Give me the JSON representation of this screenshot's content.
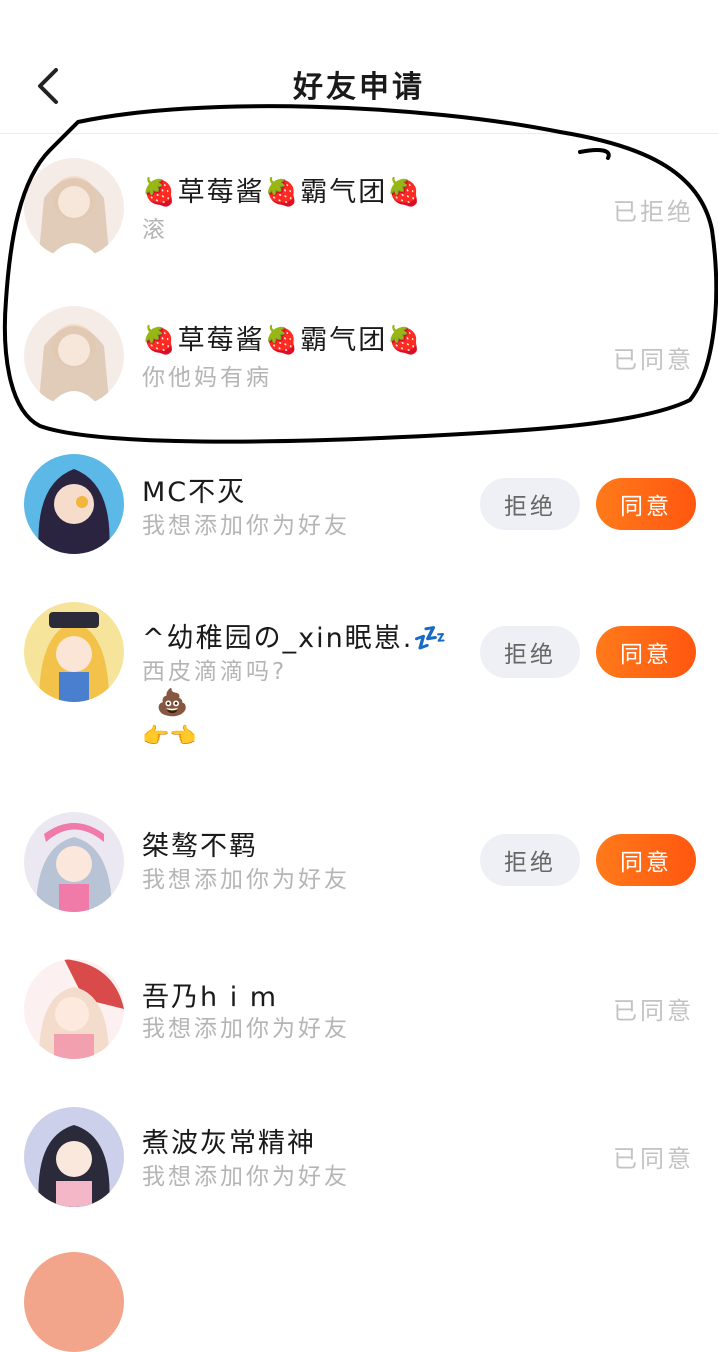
{
  "header": {
    "title": "好友申请",
    "back_icon": "chevron-left-icon"
  },
  "requests": [
    {
      "name": "🍓草莓酱🍓霸气团🍓",
      "message": "滚",
      "status": "已拒绝",
      "avatar_colors": [
        "#f3e6e0",
        "#d9c2b0"
      ]
    },
    {
      "name": "🍓草莓酱🍓霸气团🍓",
      "message": "你他妈有病",
      "status": "已同意",
      "avatar_colors": [
        "#f3e6e0",
        "#d9c2b0"
      ]
    },
    {
      "name": "MC不灭",
      "message": "我想添加你为好友",
      "reject_label": "拒绝",
      "accept_label": "同意",
      "avatar_colors": [
        "#4aa6d6",
        "#2b2440"
      ]
    },
    {
      "name": "^幼稚园の_xin眠崽.💤",
      "message": "西皮滴滴吗?",
      "extra_line1": "💩",
      "extra_line2": "👉👈",
      "reject_label": "拒绝",
      "accept_label": "同意",
      "avatar_colors": [
        "#f7d36b",
        "#5b8fd9"
      ]
    },
    {
      "name": "桀骜不羁",
      "message": "我想添加你为好友",
      "reject_label": "拒绝",
      "accept_label": "同意",
      "avatar_colors": [
        "#e6e2ee",
        "#f07aa8"
      ]
    },
    {
      "name": "吾乃h i m",
      "message": "我想添加你为好友",
      "status": "已同意",
      "avatar_colors": [
        "#f8e6e6",
        "#d94a4a"
      ]
    },
    {
      "name": "煮波灰常精神",
      "message": "我想添加你为好友",
      "status": "已同意",
      "avatar_colors": [
        "#c9cbe8",
        "#2a2a3a"
      ]
    }
  ],
  "colors": {
    "accept": "#ff5f14",
    "reject_bg": "#eef0f5",
    "muted": "#b5b5b5",
    "annotation": "#000000"
  }
}
